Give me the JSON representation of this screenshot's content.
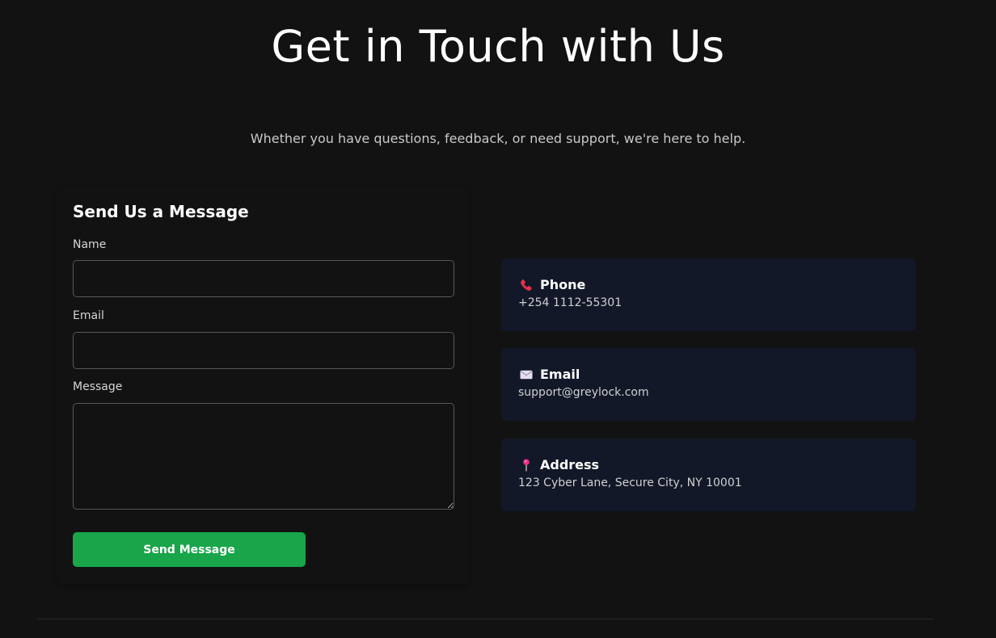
{
  "header": {
    "title": "Get in Touch with Us",
    "subtitle": "Whether you have questions, feedback, or need support, we're here to help."
  },
  "form": {
    "heading": "Send Us a Message",
    "name_label": "Name",
    "name_value": "",
    "email_label": "Email",
    "email_value": "",
    "message_label": "Message",
    "message_value": "",
    "submit_label": "Send Message",
    "submit_color": "#19a54a"
  },
  "contact_info": {
    "card_background": "#131828",
    "phone": {
      "icon": "phone-icon",
      "title": "Phone",
      "value": "+254 1112-55301"
    },
    "email": {
      "icon": "envelope-icon",
      "title": "Email",
      "value": "support@greylock.com"
    },
    "address": {
      "icon": "map-pin-icon",
      "title": "Address",
      "value": "123 Cyber Lane, Secure City, NY 10001"
    }
  }
}
